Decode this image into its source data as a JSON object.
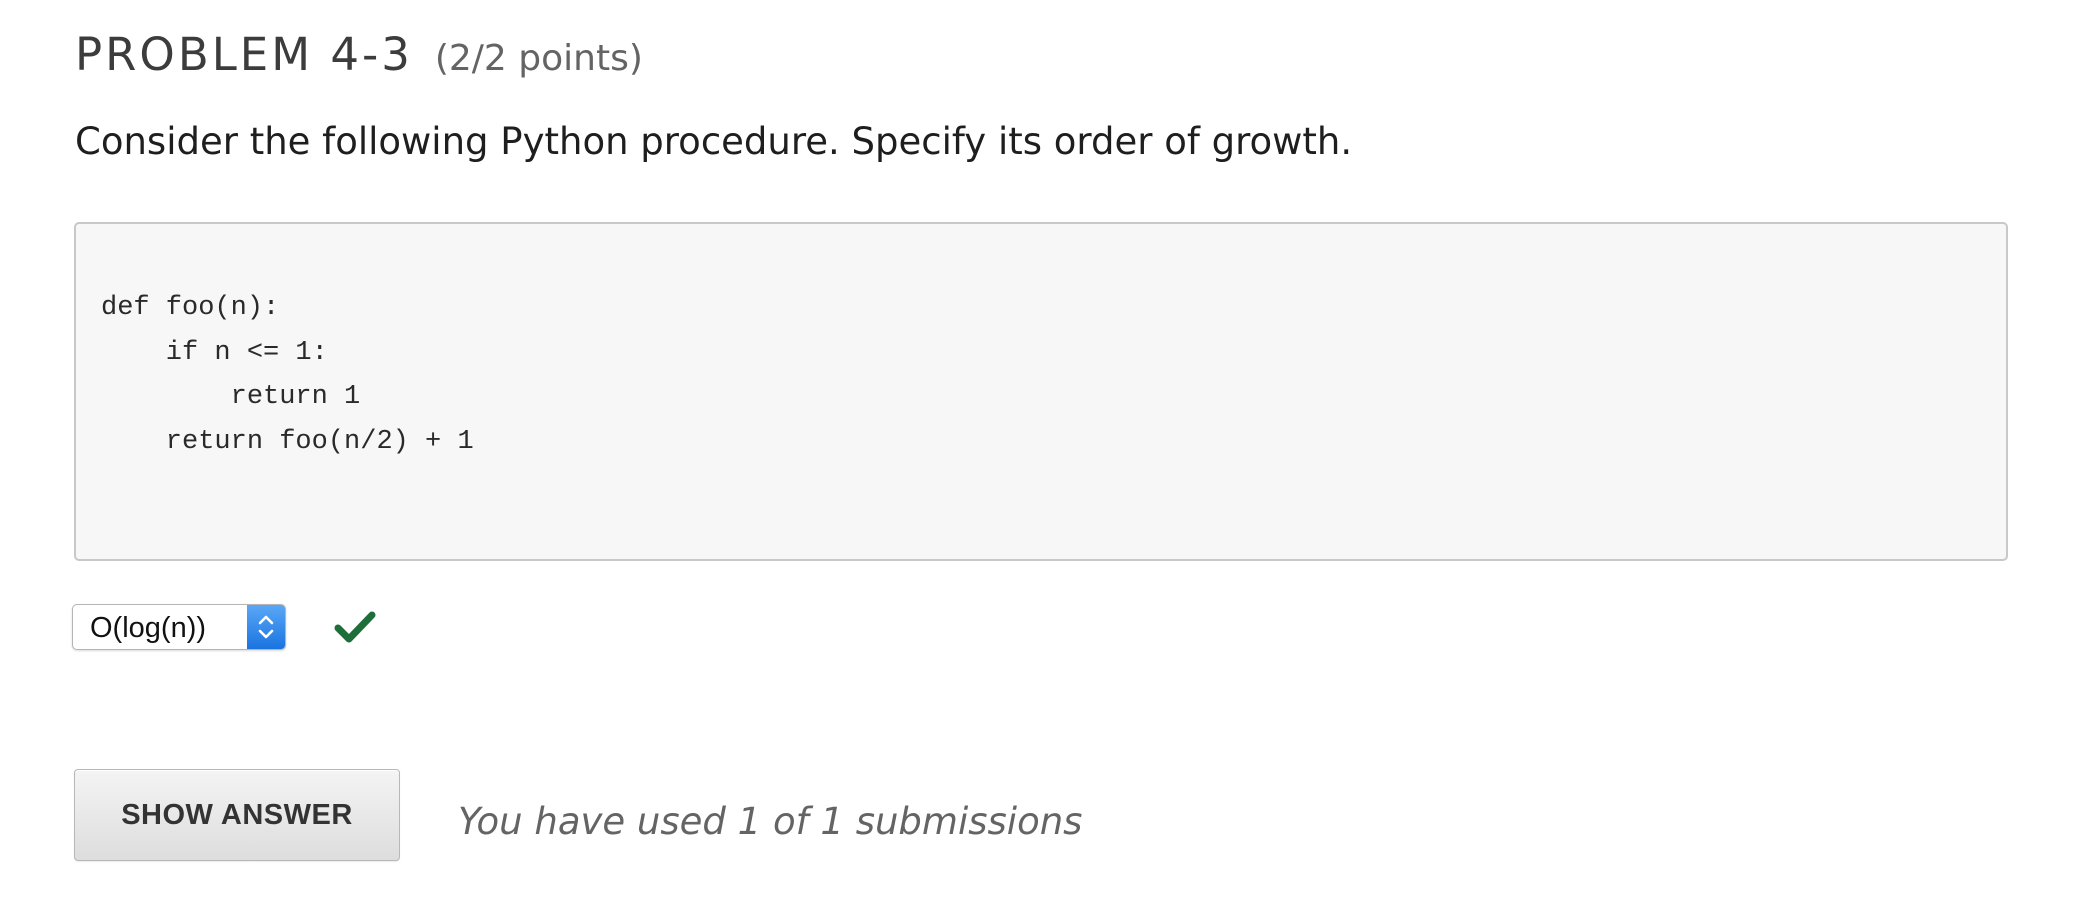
{
  "problem": {
    "title": "PROBLEM 4-3",
    "points": "(2/2 points)",
    "prompt": "Consider the following Python procedure. Specify its order of growth."
  },
  "code": {
    "lines": [
      "def foo(n):",
      "    if n <= 1:",
      "        return 1",
      "    return foo(n/2) + 1"
    ]
  },
  "answer": {
    "selected_value": "O(log(n))",
    "select_arrows_icon": "up-down-chevron-icon",
    "status_icon": "checkmark-icon",
    "status_color": "#1e6e3a",
    "select_accent_color": "#1a74e0"
  },
  "actions": {
    "show_answer_label": "SHOW ANSWER",
    "submission_text": "You have used 1 of 1 submissions"
  }
}
